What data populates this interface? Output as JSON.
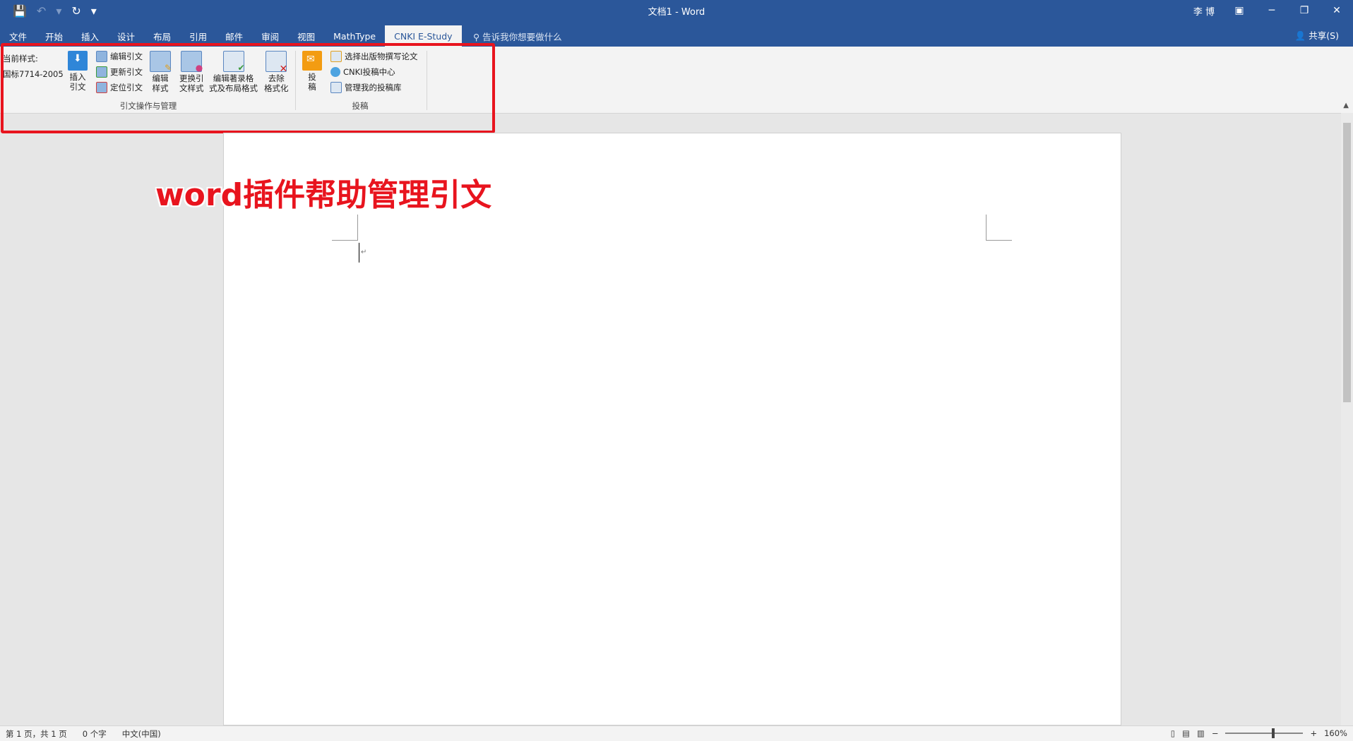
{
  "window": {
    "title": "文档1 - Word",
    "user": "李 博"
  },
  "qat": {
    "save": "💾",
    "undo": "↶",
    "undo_dd": "▾",
    "redo": "↻",
    "customize": "▾"
  },
  "tabs": [
    "文件",
    "开始",
    "插入",
    "设计",
    "布局",
    "引用",
    "邮件",
    "审阅",
    "视图",
    "MathType",
    "CNKI E-Study"
  ],
  "tellme": "告诉我你想要做什么",
  "share": "共享(S)",
  "ribbon": {
    "current_style_label": "当前样式:",
    "current_style_value": "国标7714-2005",
    "insert_citation": [
      "插入",
      "引文"
    ],
    "small_buttons": [
      "编辑引文",
      "更新引文",
      "定位引文"
    ],
    "edit_style": [
      "编辑",
      "样式"
    ],
    "change_style": [
      "更换引",
      "文样式"
    ],
    "edit_bib_layout": [
      "编辑著录格",
      "式及布局格式"
    ],
    "remove_format": [
      "去除",
      "格式化"
    ],
    "group1_label": "引文操作与管理",
    "submit": [
      "投",
      "稿"
    ],
    "submit_small": [
      "选择出版物撰写论文",
      "CNKI投稿中心",
      "管理我的投稿库"
    ],
    "group2_label": "投稿"
  },
  "annotation": "word插件帮助管理引文",
  "status": {
    "page": "第 1 页，共 1 页",
    "words": "0 个字",
    "lang": "中文(中国)",
    "zoom": "160%",
    "zoom_fraction": 0.6
  },
  "colors": {
    "title_bar": "#2b579a",
    "highlight": "#e8141e"
  }
}
